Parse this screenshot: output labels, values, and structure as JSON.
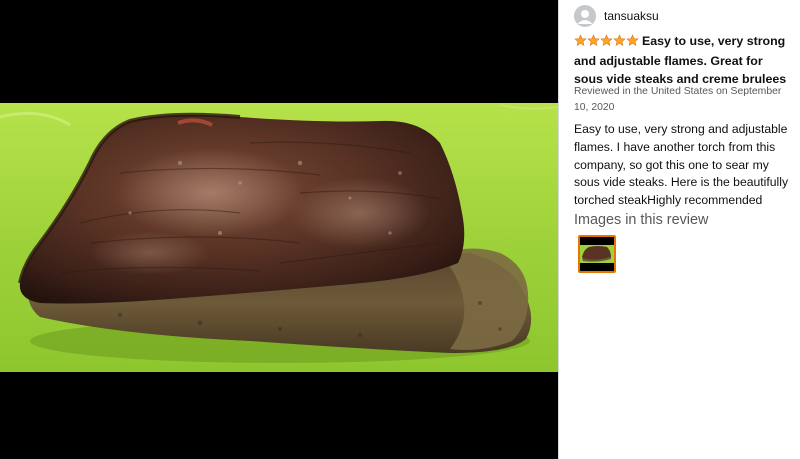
{
  "viewer": {
    "image_alt": "Torched sous vide steak on a green cutting board"
  },
  "review": {
    "reviewer_name": "tansuaksu",
    "rating": 5,
    "rating_max": 5,
    "star_color": "#ffa41c",
    "headline": "Easy to use, very strong and adjustable flames. Great for sous vide steaks and creme brulees",
    "meta": "Reviewed in the United States on September 10, 2020",
    "body": "Easy to use, very strong and adjustable flames. I have another torch from this company, so got this one to sear my sous vide steaks. Here is the beautifully torched steakHighly recommended",
    "images_heading": "Images in this review",
    "thumbnail_selected": true,
    "thumbnail_border_color": "#e77600"
  }
}
